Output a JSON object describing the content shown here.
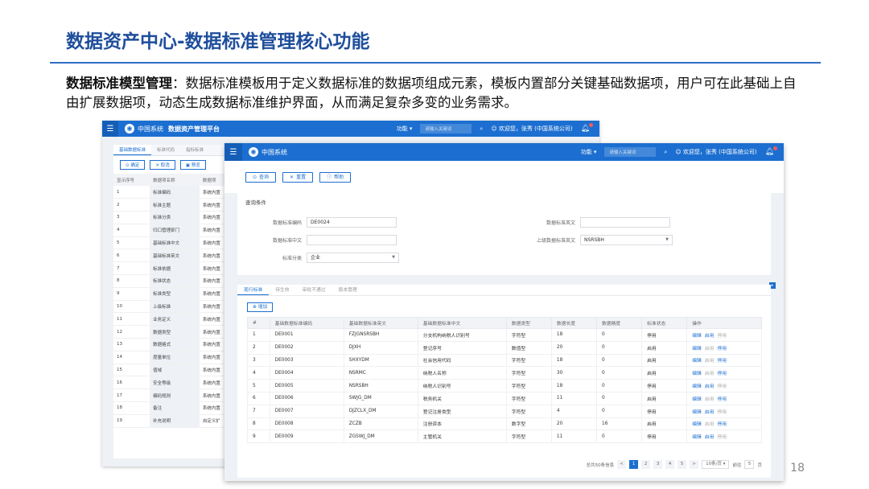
{
  "slide": {
    "title": "数据资产中心-数据标准管理核心功能",
    "desc_bold": "数据标准模型管理",
    "desc_text": "：数据标准模板用于定义数据标准的数据项组成元素，模板内置部分关键基础数据项，用户可在此基础上自由扩展数据项，动态生成数据标准维护界面，从而满足复杂多变的业务需求。",
    "page_number": "18"
  },
  "back_window": {
    "brand": "中国系统",
    "platform": "数据资产管理平台",
    "func": "功能",
    "search_placeholder": "请输入关键词",
    "welcome": "欢迎您，张秀 (中国系统公司)",
    "tabs": [
      "基础数据标准",
      "标准代码",
      "指标标准"
    ],
    "buttons": [
      "确定",
      "取消",
      "预览"
    ],
    "columns": [
      "显示序号",
      "数据项名称",
      "数据项"
    ],
    "rows": [
      [
        "1",
        "标准编码",
        "系统内置"
      ],
      [
        "2",
        "标准主题",
        "系统内置"
      ],
      [
        "3",
        "标准分类",
        "系统内置"
      ],
      [
        "4",
        "归口管理部门",
        "系统内置"
      ],
      [
        "5",
        "基础标准中文",
        "系统内置"
      ],
      [
        "6",
        "基础标准英文",
        "系统内置"
      ],
      [
        "7",
        "标准依据",
        "系统内置"
      ],
      [
        "8",
        "标准状态",
        "系统内置"
      ],
      [
        "9",
        "标准类型",
        "系统内置"
      ],
      [
        "10",
        "上级标准",
        "系统内置"
      ],
      [
        "11",
        "业务定义",
        "系统内置"
      ],
      [
        "12",
        "数据类型",
        "系统内置"
      ],
      [
        "13",
        "数据格式",
        "系统内置"
      ],
      [
        "14",
        "度量单位",
        "系统内置"
      ],
      [
        "15",
        "值域",
        "系统内置"
      ],
      [
        "16",
        "安全等级",
        "系统内置"
      ],
      [
        "17",
        "编码规则",
        "系统内置"
      ],
      [
        "18",
        "备注",
        "系统内置"
      ],
      [
        "19",
        "补充说明",
        "自定义扩"
      ]
    ]
  },
  "front_window": {
    "brand": "中国系统",
    "func": "功能",
    "search_placeholder": "请输入关键词",
    "welcome": "欢迎您，张秀 (中国系统公司)",
    "toolbar": [
      "查询",
      "重置",
      "帮助"
    ],
    "query": {
      "title": "查询条件",
      "code_label": "数据标准编码",
      "code_value": "DE0024",
      "en_label": "数据标准英文",
      "en_value": "",
      "cn_label": "数据标准中文",
      "cn_value": "",
      "parent_label": "上级数据标准英文",
      "parent_value": "NSRSBH",
      "cat_label": "标准分类",
      "cat_value": "企业"
    },
    "tabs": [
      "现行标准",
      "待生效",
      "审批不通过",
      "版本管理"
    ],
    "add_label": "增加",
    "columns": [
      "#",
      "基础数据标准编码",
      "基础数据标准英文",
      "基础数据标准中文",
      "数据类型",
      "数据长度",
      "数据精度",
      "标准状态",
      "操作"
    ],
    "rows": [
      {
        "no": "1",
        "code": "DE0001",
        "en": "FZJGNSRSBH",
        "cn": "分支机构纳税人识别号",
        "type": "字符型",
        "len": "18",
        "prec": "0",
        "status": "停用",
        "ops": [
          "编辑",
          "启用",
          "停用"
        ],
        "active": [
          true,
          true,
          false
        ]
      },
      {
        "no": "2",
        "code": "DE0002",
        "en": "DJXH",
        "cn": "登记序号",
        "type": "数值型",
        "len": "20",
        "prec": "0",
        "status": "启用",
        "ops": [
          "编辑",
          "启用",
          "停用"
        ],
        "active": [
          true,
          false,
          true
        ]
      },
      {
        "no": "3",
        "code": "DE0003",
        "en": "SHXYDM",
        "cn": "社会信用代码",
        "type": "字符型",
        "len": "18",
        "prec": "0",
        "status": "启用",
        "ops": [
          "编辑",
          "启用",
          "停用"
        ],
        "active": [
          true,
          false,
          true
        ]
      },
      {
        "no": "4",
        "code": "DE0004",
        "en": "NSRMC",
        "cn": "纳税人名称",
        "type": "字符型",
        "len": "30",
        "prec": "0",
        "status": "启用",
        "ops": [
          "编辑",
          "启用",
          "停用"
        ],
        "active": [
          true,
          false,
          true
        ]
      },
      {
        "no": "5",
        "code": "DE0005",
        "en": "NSRSBH",
        "cn": "纳税人识别号",
        "type": "字符型",
        "len": "18",
        "prec": "0",
        "status": "停用",
        "ops": [
          "编辑",
          "启用",
          "停用"
        ],
        "active": [
          true,
          true,
          false
        ]
      },
      {
        "no": "6",
        "code": "DE0006",
        "en": "SWJG_DM",
        "cn": "税务机关",
        "type": "字符型",
        "len": "11",
        "prec": "0",
        "status": "启用",
        "ops": [
          "编辑",
          "启用",
          "停用"
        ],
        "active": [
          true,
          false,
          true
        ]
      },
      {
        "no": "7",
        "code": "DE0007",
        "en": "DJZCLX_DM",
        "cn": "登记注册类型",
        "type": "字符型",
        "len": "4",
        "prec": "0",
        "status": "停用",
        "ops": [
          "编辑",
          "启用",
          "停用"
        ],
        "active": [
          true,
          true,
          false
        ]
      },
      {
        "no": "8",
        "code": "DE0008",
        "en": "ZCZB",
        "cn": "注册资本",
        "type": "数字型",
        "len": "20",
        "prec": "16",
        "status": "启用",
        "ops": [
          "编辑",
          "启用",
          "停用"
        ],
        "active": [
          true,
          false,
          true
        ]
      },
      {
        "no": "9",
        "code": "DE0009",
        "en": "ZGSWJ_DM",
        "cn": "主管机关",
        "type": "字符型",
        "len": "11",
        "prec": "0",
        "status": "停用",
        "ops": [
          "编辑",
          "启用",
          "停用"
        ],
        "active": [
          true,
          true,
          false
        ]
      }
    ],
    "pager": {
      "total": "总共50条信息",
      "pages": [
        "1",
        "2",
        "3",
        "4",
        "5"
      ],
      "current": "1",
      "prev": "<",
      "next": ">",
      "page_size": "10条/页",
      "goto_label": "前往",
      "goto_value": "5",
      "goto_suffix": "页"
    }
  }
}
